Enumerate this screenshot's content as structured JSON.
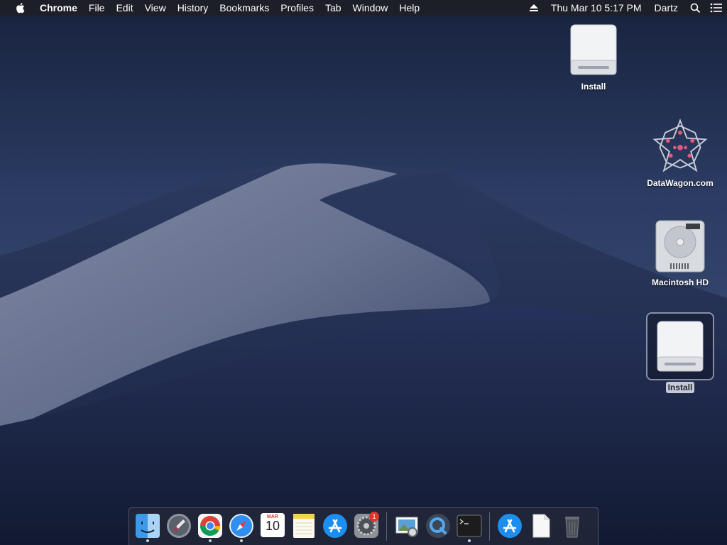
{
  "menubar": {
    "app_name": "Chrome",
    "menus": [
      "File",
      "Edit",
      "View",
      "History",
      "Bookmarks",
      "Profiles",
      "Tab",
      "Window",
      "Help"
    ],
    "clock": "Thu Mar 10  5:17 PM",
    "user": "Dartz"
  },
  "desktop_icons": [
    {
      "label": "Install",
      "icon": "external-drive-icon",
      "selected": false
    },
    {
      "label": "DataWagon.com",
      "icon": "datawagon-logo-icon",
      "selected": false
    },
    {
      "label": "Macintosh HD",
      "icon": "hard-drive-icon",
      "selected": false
    },
    {
      "label": "Install",
      "icon": "external-drive-icon",
      "selected": true
    }
  ],
  "dock": {
    "calendar": {
      "month": "MAR",
      "day": "10"
    },
    "system_preferences_badge": "1",
    "apps": [
      "finder-icon",
      "launchpad-icon",
      "chrome-icon",
      "safari-icon",
      "calendar-icon",
      "notes-icon",
      "app-store-icon",
      "system-preferences-icon",
      "preview-icon",
      "quicktime-icon",
      "terminal-icon",
      "app-store-downloads-icon",
      "document-icon",
      "trash-icon"
    ]
  }
}
